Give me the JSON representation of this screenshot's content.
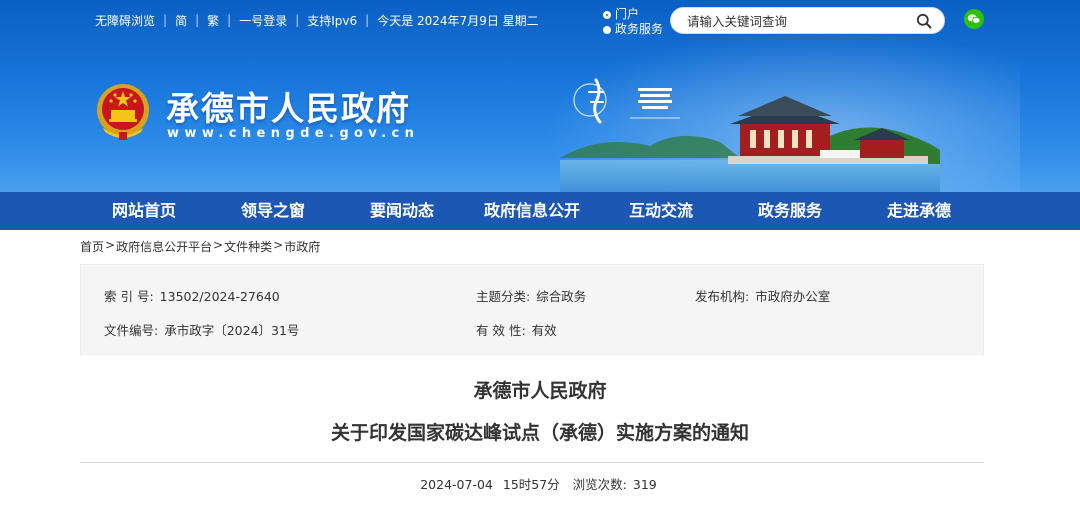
{
  "topbar": {
    "accessibility": "无障碍浏览",
    "simplified": "简",
    "traditional": "繁",
    "login": "一号登录",
    "ipv6": "支持Ipv6",
    "date": "今天是 2024年7月9日 星期二"
  },
  "search": {
    "scope_options": [
      "门户",
      "政务服务"
    ],
    "selected_scope": "门户",
    "placeholder": "请输入关键词查询"
  },
  "site": {
    "title": "承德市人民政府",
    "url": "www.chengde.gov.cn"
  },
  "nav": {
    "items": [
      "网站首页",
      "领导之窗",
      "要闻动态",
      "政府信息公开",
      "互动交流",
      "政务服务",
      "走进承德"
    ]
  },
  "breadcrumb": [
    "首页",
    "政府信息公开平台",
    "文件种类",
    "市政府"
  ],
  "meta": {
    "index_label": "索 引 号:",
    "index_value": "13502/2024-27640",
    "topic_label": "主题分类:",
    "topic_value": "综合政务",
    "publisher_label": "发布机构:",
    "publisher_value": "市政府办公室",
    "doc_no_label": "文件编号:",
    "doc_no_value": "承市政字〔2024〕31号",
    "validity_label": "有 效 性:",
    "validity_value": "有效"
  },
  "article": {
    "title_line1": "承德市人民政府",
    "title_line2": "关于印发国家碳达峰试点（承德）实施方案的通知",
    "date": "2024-07-04",
    "time": "15时57分",
    "views_label": "浏览次数:",
    "views": "319"
  },
  "colors": {
    "header_blue": "#1a78dc",
    "nav_blue": "#1b57b3",
    "wechat_green": "#2dc100"
  }
}
